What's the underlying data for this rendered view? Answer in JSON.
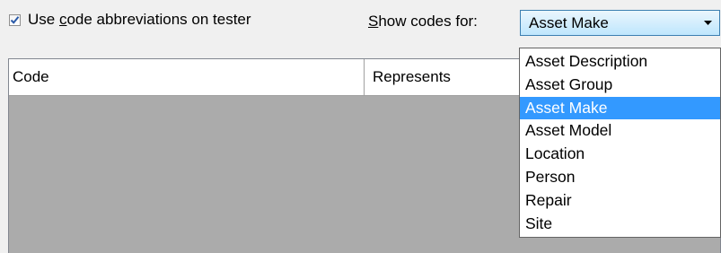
{
  "checkbox": {
    "checked": true,
    "label_prefix": "Use ",
    "label_mnemonic": "c",
    "label_suffix": "ode abbreviations on tester"
  },
  "show_codes": {
    "label_mnemonic": "S",
    "label_suffix": "how codes for:",
    "selected_value": "Asset Make"
  },
  "grid": {
    "columns": [
      "Code",
      "Represents"
    ]
  },
  "dropdown": {
    "options": [
      "Asset Description",
      "Asset Group",
      "Asset Make",
      "Asset Model",
      "Location",
      "Person",
      "Repair",
      "Site"
    ],
    "selected_index": 2
  },
  "colors": {
    "selection": "#3399ff",
    "grid_background": "#ababab",
    "window_background": "#f0f0f0"
  }
}
